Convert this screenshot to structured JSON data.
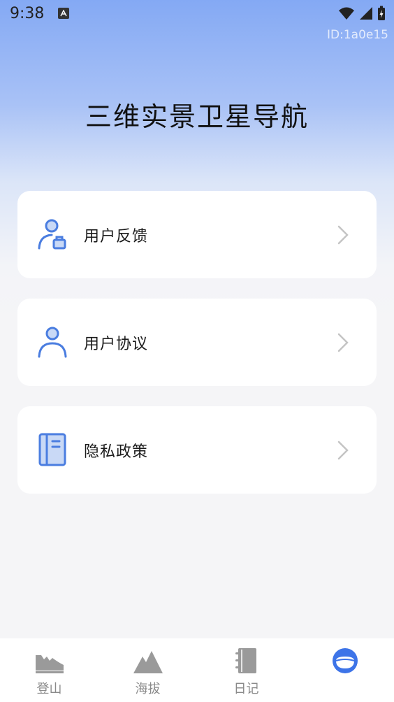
{
  "status_bar": {
    "time": "9:38"
  },
  "watermark": "ID:1a0e15",
  "app_title": "三维实景卫星导航",
  "menu": [
    {
      "label": "用户反馈",
      "icon": "user-feedback-icon"
    },
    {
      "label": "用户协议",
      "icon": "user-icon"
    },
    {
      "label": "隐私政策",
      "icon": "book-icon"
    }
  ],
  "tabs": [
    {
      "label": "登山",
      "icon": "shoe-icon",
      "active": false
    },
    {
      "label": "海拔",
      "icon": "mountain-icon",
      "active": false
    },
    {
      "label": "日记",
      "icon": "notebook-icon",
      "active": false
    },
    {
      "label": "",
      "icon": "profile-icon",
      "active": true
    }
  ],
  "colors": {
    "accent": "#4a7de0",
    "icon_gray": "#9a9a9a",
    "active_tab": "#3d74e8"
  }
}
